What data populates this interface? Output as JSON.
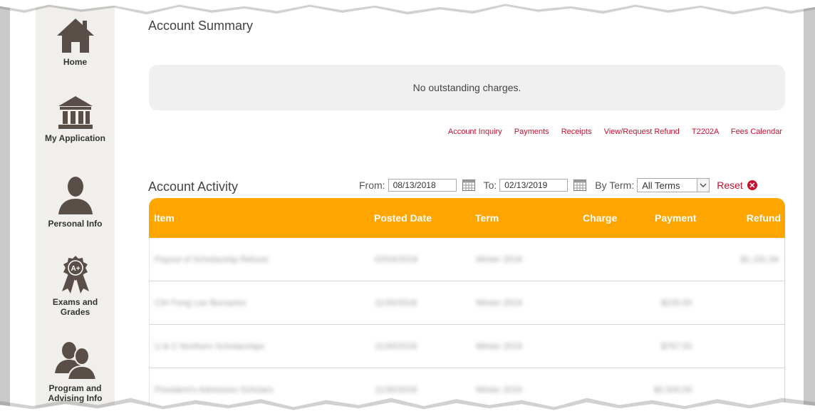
{
  "sidebar": {
    "items": [
      {
        "label": "Home",
        "icon": "home-icon"
      },
      {
        "label": "My Application",
        "icon": "building-icon"
      },
      {
        "label": "Personal Info",
        "icon": "person-icon"
      },
      {
        "label": "Exams and Grades",
        "icon": "award-icon"
      },
      {
        "label": "Program and Advising Info",
        "icon": "people-icon"
      }
    ]
  },
  "summary": {
    "title": "Account Summary",
    "notice": "No outstanding charges.",
    "links": [
      "Account Inquiry",
      "Payments",
      "Receipts",
      "View/Request Refund",
      "T2202A",
      "Fees Calendar"
    ]
  },
  "activity": {
    "title": "Account Activity",
    "from_label": "From:",
    "from_value": "08/13/2018",
    "to_label": "To:",
    "to_value": "02/13/2019",
    "term_label": "By Term:",
    "term_value": "All Terms",
    "reset_label": "Reset"
  },
  "table": {
    "headers": [
      "Item",
      "Posted Date",
      "Term",
      "Charge",
      "Payment",
      "Refund"
    ],
    "rows": [
      [
        "Payout of Scholarship Refund",
        "02/04/2019",
        "Winter 2019",
        "",
        "",
        "$1,191.94"
      ],
      [
        "CIH Feng Lee Bursaries",
        "11/30/2018",
        "Winter 2019",
        "",
        "$225.00",
        ""
      ],
      [
        "U & C Northern Scholarships",
        "11/30/2018",
        "Winter 2019",
        "",
        "$787.50",
        ""
      ],
      [
        "President's Admission Scholars",
        "11/30/2018",
        "Winter 2019",
        "",
        "$2,500.00",
        ""
      ]
    ]
  },
  "colors": {
    "accent": "#ffa500",
    "link": "#c8102e",
    "icon": "#5a4e48",
    "sidebar_bg": "#f1efeb"
  }
}
